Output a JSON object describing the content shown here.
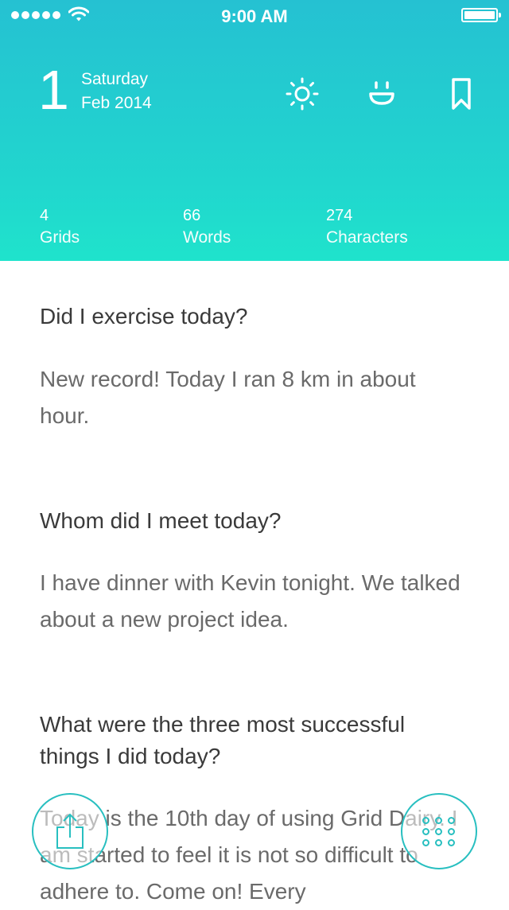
{
  "status_bar": {
    "time": "9:00 AM",
    "signal_dots": 5,
    "battery_level": 1.0
  },
  "date": {
    "day_number": "1",
    "weekday": "Saturday",
    "month_year": "Feb 2014"
  },
  "header_icons": [
    "sun-icon",
    "smile-icon",
    "bookmark-icon"
  ],
  "stats": {
    "grids": {
      "value": "4",
      "label": "Grids"
    },
    "words": {
      "value": "66",
      "label": "Words"
    },
    "characters": {
      "value": "274",
      "label": "Characters"
    }
  },
  "entries": [
    {
      "question": "Did I exercise today?",
      "answer": "New record! Today I ran 8 km in about  hour."
    },
    {
      "question": "Whom did I meet today?",
      "answer": "I have dinner with Kevin tonight.  We talked about a new project idea."
    },
    {
      "question": "What were the three most successful things I did today?",
      "answer": "Today is the 10th day of using Grid Dairy. I am started to feel it is not so difficult to adhere to.  Come on! Every"
    }
  ],
  "fab_icons": {
    "left": "share-icon",
    "right": "grid-dots-icon"
  },
  "colors": {
    "header_top": "#25c1d2",
    "header_bottom": "#1fe3cc",
    "accent": "#28bfc0",
    "question_text": "#3a3a3a",
    "answer_text": "#6a6a6a"
  }
}
